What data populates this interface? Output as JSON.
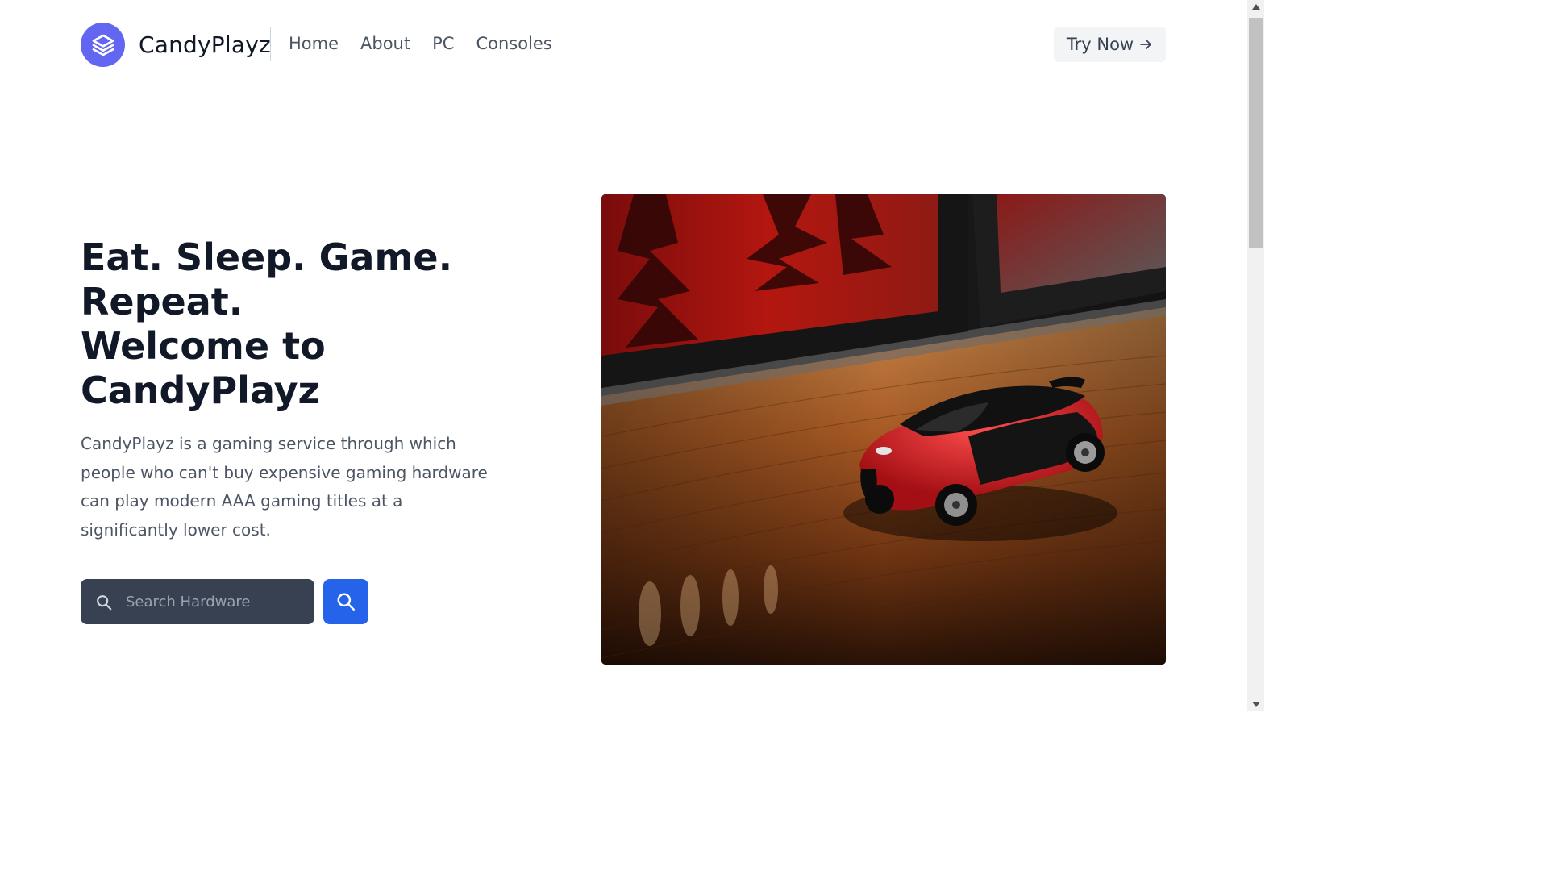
{
  "header": {
    "brand": "CandyPlayz",
    "nav": [
      "Home",
      "About",
      "PC",
      "Consoles"
    ],
    "cta_label": "Try Now",
    "cta_icon": "arrow-right-icon"
  },
  "hero": {
    "title_lines": [
      "Eat. Sleep. Game.",
      "Repeat.",
      "Welcome to",
      "CandyPlayz"
    ],
    "description": "CandyPlayz is a gaming service through which people who can't buy expensive gaming hardware can play modern AAA gaming titles at a significantly lower cost.",
    "search": {
      "placeholder": "Search Hardware",
      "value": ""
    },
    "image_subject": "toy sports car on wooden desk in front of red monitors"
  },
  "colors": {
    "brand_accent": "#6366f1",
    "search_button": "#2563eb",
    "search_box": "#374151"
  }
}
